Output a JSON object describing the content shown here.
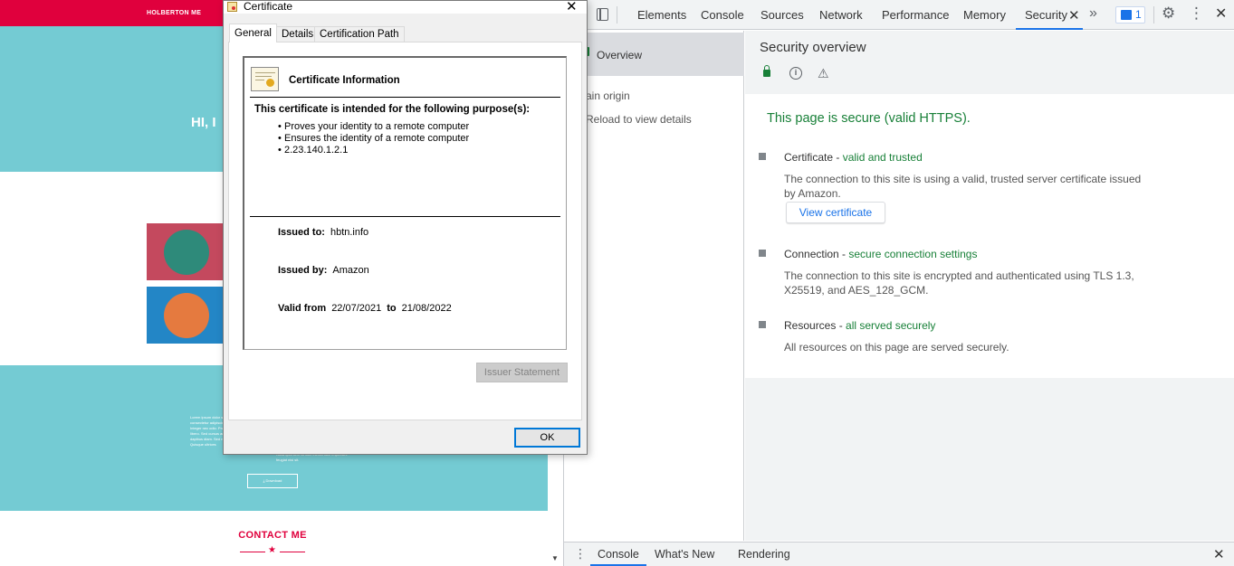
{
  "website": {
    "brand": "HOLBERTON ME",
    "hero_text": "HI, I",
    "lorem_left": "Lorem ipsum dolor sit amet, consectetur adipiscing elit. Integer nec odio. Praesent libero. Sed cursus ante dapibus diam. Sed nisi. Quisque ultrices",
    "lorem_right": "Nulla quis sem at nibh elementum imperdiet. feugiat nisi sit.",
    "download_label": "⤓ Download",
    "contact_heading": "CONTACT ME"
  },
  "devtools": {
    "tabs": [
      "Elements",
      "Console",
      "Sources",
      "Network",
      "Performance",
      "Memory",
      "Security"
    ],
    "active_tab": "Security",
    "issues_count": "1",
    "sidebar": {
      "overview": "Overview",
      "main_origin": "ain origin",
      "reload": "Reload to view details"
    },
    "overview": {
      "title": "Security overview",
      "headline": "This page is secure (valid HTTPS).",
      "certificate": {
        "label": "Certificate - ",
        "status": "valid and trusted",
        "description": "The connection to this site is using a valid, trusted server certificate issued by Amazon.",
        "button": "View certificate"
      },
      "connection": {
        "label": "Connection - ",
        "status": "secure connection settings",
        "description": "The connection to this site is encrypted and authenticated using TLS 1.3, X25519, and AES_128_GCM."
      },
      "resources": {
        "label": "Resources - ",
        "status": "all served securely",
        "description": "All resources on this page are served securely."
      }
    },
    "drawer_tabs": [
      "Console",
      "What's New",
      "Rendering"
    ]
  },
  "certificate_dialog": {
    "title": "Certificate",
    "tabs": [
      "General",
      "Details",
      "Certification Path"
    ],
    "active_tab": "General",
    "heading": "Certificate Information",
    "purpose_heading": "This certificate is intended for the following purpose(s):",
    "purposes": [
      "Proves your identity to a remote computer",
      "Ensures the identity of a remote computer",
      "2.23.140.1.2.1"
    ],
    "issued_to_label": "Issued to:",
    "issued_to": "hbtn.info",
    "issued_by_label": "Issued by:",
    "issued_by": "Amazon",
    "valid_from_label": "Valid from",
    "valid_from": "22/07/2021",
    "to_label": "to",
    "valid_to": "21/08/2022",
    "issuer_statement": "Issuer Statement",
    "ok": "OK"
  },
  "colors": {
    "brand_red": "#e0003d",
    "teal": "#74cbd3",
    "secure_green": "#188038",
    "link_blue": "#1a73e8"
  }
}
